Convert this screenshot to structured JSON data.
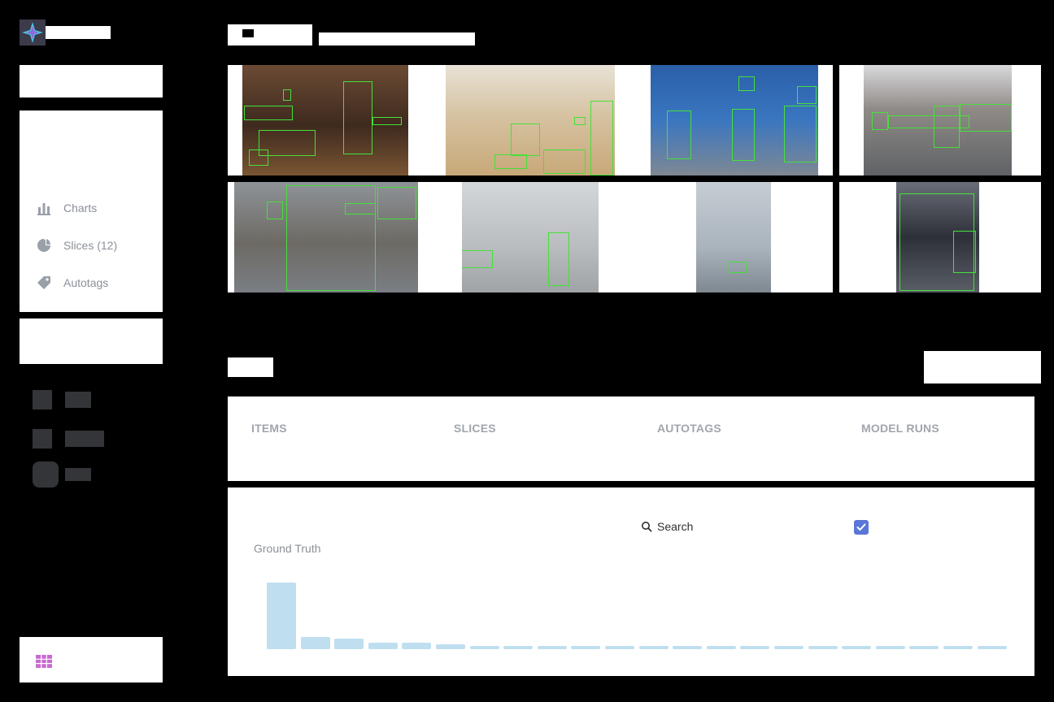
{
  "sidebar": {
    "nav": [
      {
        "label": "Charts",
        "icon": "bar-chart-icon"
      },
      {
        "label": "Slices (12)",
        "icon": "slice-icon"
      },
      {
        "label": "Autotags",
        "icon": "tag-icon"
      }
    ],
    "bottom_icon": "grid-icon"
  },
  "gallery": {
    "images": [
      {
        "id": "kitchen-utensils",
        "bg": "#5a4030"
      },
      {
        "id": "kitchen-room",
        "bg": "#d9cdb8"
      },
      {
        "id": "street-wall",
        "bg": "#2f63a8"
      },
      {
        "id": "street-plaza",
        "bg": "#8a8d92"
      },
      {
        "id": "bicycle",
        "bg": "#8b8f93"
      },
      {
        "id": "bathroom-toilet",
        "bg": "#c9ccce"
      },
      {
        "id": "bathroom-pipes",
        "bg": "#aeb6bf"
      },
      {
        "id": "motorcycle",
        "bg": "#4a4f58"
      }
    ]
  },
  "stats": {
    "headers": [
      "ITEMS",
      "SLICES",
      "AUTOTAGS",
      "MODEL RUNS"
    ]
  },
  "chart_controls": {
    "search_label": "Search",
    "checkbox_checked": true
  },
  "chart_data": {
    "type": "bar",
    "title": "Ground Truth",
    "series": [
      {
        "values": [
          100,
          18,
          16,
          10,
          10,
          7,
          5,
          5,
          5,
          5,
          5,
          5,
          5,
          5,
          5,
          5,
          5,
          5,
          5,
          5,
          5,
          5
        ]
      }
    ],
    "ylim": [
      0,
      100
    ],
    "color": "#bfdff0"
  }
}
